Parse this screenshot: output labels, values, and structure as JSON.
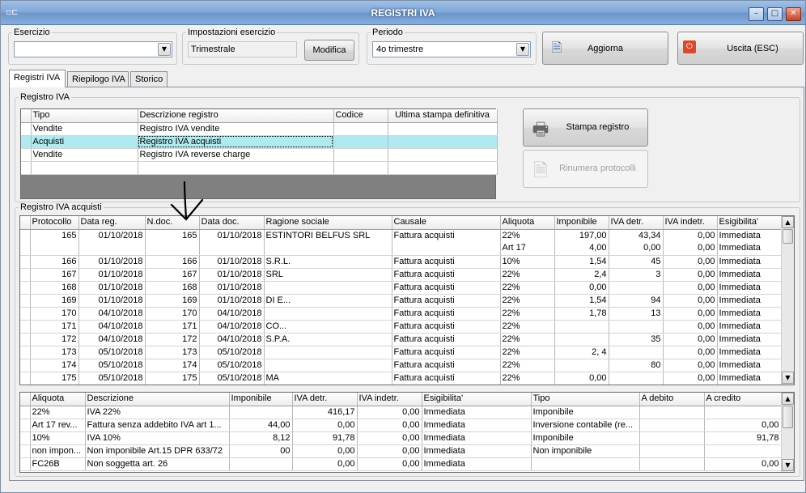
{
  "window": {
    "title": "REGISTRI IVA",
    "minimize": "–",
    "maximize": "□",
    "close": "✕",
    "app_icon": "▫⊏"
  },
  "toolbar": {
    "esercizio_label": "Esercizio",
    "esercizio_value": "",
    "impostazioni_label": "Impostazioni esercizio",
    "impostazioni_value": "Trimestrale",
    "modifica_label": "Modifica",
    "periodo_label": "Periodo",
    "periodo_value": "4o trimestre",
    "aggiorna_label": "Aggiorna",
    "uscita_label": "Uscita (ESC)",
    "aggiorna_icon": "refresh-icon",
    "uscita_icon": "exit-icon"
  },
  "tabs": [
    "Registri IVA",
    "Riepilogo IVA",
    "Storico"
  ],
  "registro_group": {
    "label": "Registro IVA",
    "columns": [
      "Tipo",
      "Descrizione registro",
      "Codice",
      "Ultima stampa definitiva"
    ],
    "rows": [
      [
        "Vendite",
        "Registro IVA vendite",
        "",
        ""
      ],
      [
        "Acquisti",
        "Registro IVA acquisti",
        "",
        ""
      ],
      [
        "Vendite",
        "Registro IVA reverse charge",
        "",
        ""
      ],
      [
        "",
        "",
        "",
        ""
      ]
    ],
    "stampa_label": "Stampa registro",
    "rinumera_label": "Rinumera protocolli"
  },
  "acquisti_group": {
    "label": "Registro IVA acquisti",
    "columns": [
      "Protocollo",
      "Data reg.",
      "N.doc.",
      "Data doc.",
      "Ragione sociale",
      "Causale",
      "Aliquota",
      "Imponibile",
      "IVA detr.",
      "IVA indetr.",
      "Esigibilita'"
    ],
    "rows": [
      [
        "165",
        "01/10/2018",
        "165",
        "01/10/2018",
        "ESTINTORI BELFUS SRL",
        "Fattura acquisti",
        "22%",
        "197,00",
        "43,34",
        "0,00",
        "Immediata"
      ],
      [
        "",
        "",
        "",
        "",
        "",
        "",
        "Art 17",
        "4,00",
        "0,00",
        "0,00",
        "Immediata"
      ],
      [
        "166",
        "01/10/2018",
        "166",
        "01/10/2018",
        "S.R.L.",
        "Fattura acquisti",
        "10%",
        "1,54",
        "45",
        "0,00",
        "Immediata"
      ],
      [
        "167",
        "01/10/2018",
        "167",
        "01/10/2018",
        "SRL",
        "Fattura acquisti",
        "22%",
        "2,4",
        "3",
        "0,00",
        "Immediata"
      ],
      [
        "168",
        "01/10/2018",
        "168",
        "01/10/2018",
        "",
        "Fattura acquisti",
        "22%",
        "0,00",
        "",
        "0,00",
        "Immediata"
      ],
      [
        "169",
        "01/10/2018",
        "169",
        "01/10/2018",
        "DI E...",
        "Fattura acquisti",
        "22%",
        "1,54",
        "94",
        "0,00",
        "Immediata"
      ],
      [
        "170",
        "04/10/2018",
        "170",
        "04/10/2018",
        "",
        "Fattura acquisti",
        "22%",
        "1,78",
        "13",
        "0,00",
        "Immediata"
      ],
      [
        "171",
        "04/10/2018",
        "171",
        "04/10/2018",
        "CO...",
        "Fattura acquisti",
        "22%",
        "",
        "",
        "0,00",
        "Immediata"
      ],
      [
        "172",
        "04/10/2018",
        "172",
        "04/10/2018",
        "S.P.A.",
        "Fattura acquisti",
        "22%",
        "",
        "35",
        "0,00",
        "Immediata"
      ],
      [
        "173",
        "05/10/2018",
        "173",
        "05/10/2018",
        "",
        "Fattura acquisti",
        "22%",
        "2, 4",
        "",
        "0,00",
        "Immediata"
      ],
      [
        "174",
        "05/10/2018",
        "174",
        "05/10/2018",
        "",
        "Fattura acquisti",
        "22%",
        "",
        "80",
        "0,00",
        "Immediata"
      ],
      [
        "175",
        "05/10/2018",
        "175",
        "05/10/2018",
        "MA",
        "Fattura acquisti",
        "22%",
        "0,00",
        "",
        "0,00",
        "Immediata"
      ]
    ]
  },
  "riepilogo": {
    "columns": [
      "Aliquota",
      "Descrizione",
      "Imponibile",
      "IVA detr.",
      "IVA indetr.",
      "Esigibilita'",
      "Tipo",
      "A debito",
      "A credito"
    ],
    "rows": [
      [
        "22%",
        "IVA 22%",
        "",
        "416,17",
        "0,00",
        "Immediata",
        "Imponibile",
        "",
        ""
      ],
      [
        "Art 17 rev...",
        "Fattura senza addebito IVA art 1...",
        "44,00",
        "0,00",
        "0,00",
        "Immediata",
        "Inversione contabile (re...",
        "",
        "0,00"
      ],
      [
        "10%",
        "IVA 10%",
        "8,12",
        "91,78",
        "0,00",
        "Immediata",
        "Imponibile",
        "",
        "91,78"
      ],
      [
        "non impon...",
        "Non imponibile Art.15 DPR 633/72",
        "00",
        "0,00",
        "0,00",
        "Immediata",
        "Non imponibile",
        "",
        ""
      ],
      [
        "FC26B",
        "Non soggetta art. 26",
        "",
        "0,00",
        "0,00",
        "Immediata",
        "",
        "",
        "0,00"
      ]
    ]
  }
}
